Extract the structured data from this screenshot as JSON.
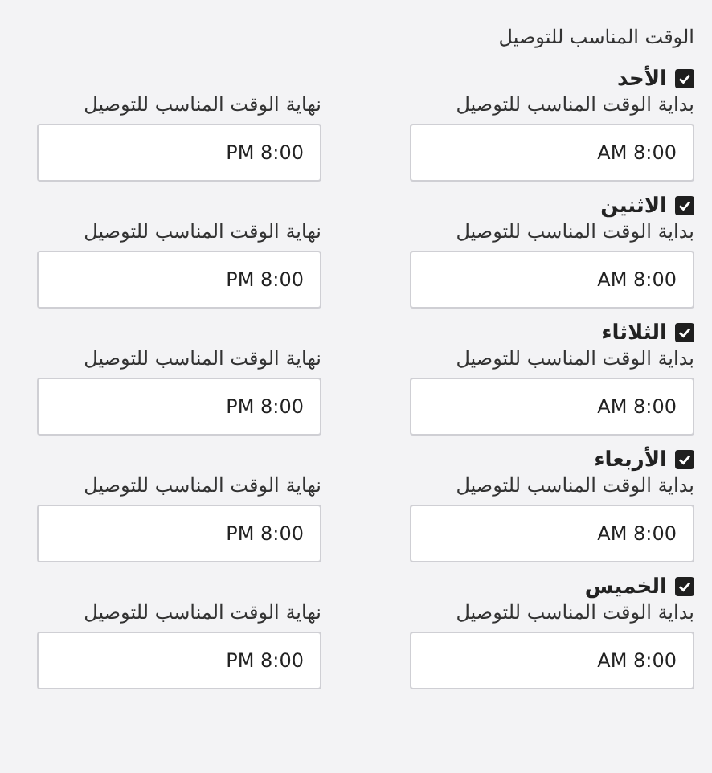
{
  "title": "الوقت المناسب للتوصيل",
  "days": [
    {
      "name": "الأحد",
      "checked": true,
      "start_label": "بداية الوقت المناسب للتوصيل",
      "start_value": "AM 8:00",
      "end_label": "نهاية الوقت المناسب للتوصيل",
      "end_value": "PM 8:00"
    },
    {
      "name": "الاثنين",
      "checked": true,
      "start_label": "بداية الوقت المناسب للتوصيل",
      "start_value": "AM 8:00",
      "end_label": "نهاية الوقت المناسب للتوصيل",
      "end_value": "PM 8:00"
    },
    {
      "name": "الثلاثاء",
      "checked": true,
      "start_label": "بداية الوقت المناسب للتوصيل",
      "start_value": "AM 8:00",
      "end_label": "نهاية الوقت المناسب للتوصيل",
      "end_value": "PM 8:00"
    },
    {
      "name": "الأربعاء",
      "checked": true,
      "start_label": "بداية الوقت المناسب للتوصيل",
      "start_value": "AM 8:00",
      "end_label": "نهاية الوقت المناسب للتوصيل",
      "end_value": "PM 8:00"
    },
    {
      "name": "الخميس",
      "checked": true,
      "start_label": "بداية الوقت المناسب للتوصيل",
      "start_value": "AM 8:00",
      "end_label": "نهاية الوقت المناسب للتوصيل",
      "end_value": "PM 8:00"
    }
  ]
}
